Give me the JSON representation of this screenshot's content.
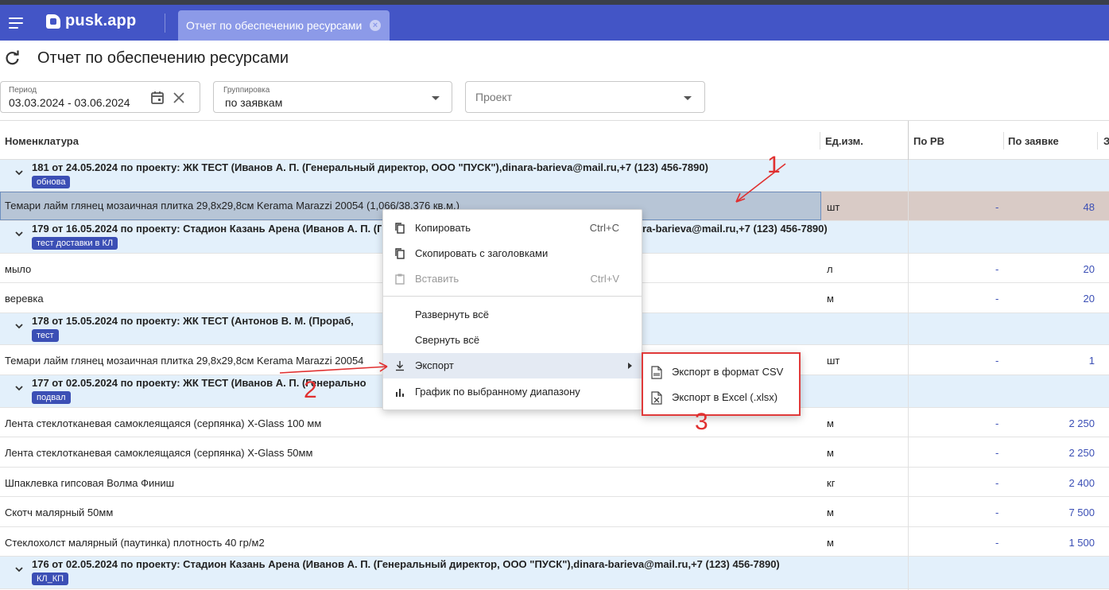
{
  "app": {
    "logo_text": "pusk.app",
    "tab_label": "Отчет по обеспечению ресурсами",
    "tab_close": "×"
  },
  "page": {
    "title": "Отчет по обеспечению ресурсами"
  },
  "filters": {
    "period_label": "Период",
    "period_value": "03.03.2024 - 03.06.2024",
    "grouping_label": "Группировка",
    "grouping_value": "по заявкам",
    "project_placeholder": "Проект"
  },
  "columns": {
    "nomenclature": "Номенклатура",
    "unit": "Ед.изм.",
    "by_rv": "По РВ",
    "by_request": "По заявке",
    "cut": "З"
  },
  "groups": [
    {
      "title": "181 от 24.05.2024 по проекту: ЖК ТЕСТ (Иванов А. П. (Генеральный директор, ООО \"ПУСК\"),dinara-barieva@mail.ru,+7 (123) 456-7890)",
      "tag": "обнова",
      "items": [
        {
          "name": "Темари лайм глянец мозаичная плитка 29,8x29,8см Kerama Marazzi 20054 (1,066/38,376 кв.м.)",
          "unit": "шт",
          "pv": "-",
          "qty": "48"
        }
      ]
    },
    {
      "title": "179 от 16.05.2024 по проекту: Стадион Казань Арена (Иванов А. П. (Генеральный директор, ООО \"ПУСК\"),dinara-barieva@mail.ru,+7 (123) 456-7890)",
      "tag": "тест доставки в КЛ",
      "items": [
        {
          "name": "мыло",
          "unit": "л",
          "pv": "-",
          "qty": "20"
        },
        {
          "name": "веревка",
          "unit": "м",
          "pv": "-",
          "qty": "20"
        }
      ]
    },
    {
      "title": "178 от 15.05.2024 по проекту: ЖК ТЕСТ (Антонов В. М. (Прораб,",
      "tag": "тест",
      "items": [
        {
          "name": "Темари лайм глянец мозаичная плитка 29,8x29,8см Kerama Marazzi 20054",
          "unit": "шт",
          "pv": "-",
          "qty": "1"
        }
      ]
    },
    {
      "title": "177 от 02.05.2024 по проекту: ЖК ТЕСТ (Иванов А. П. (Генерально",
      "tag": "подвал",
      "items": [
        {
          "name": "Лента стеклотканевая самоклеящаяся (серпянка) X-Glass 100 мм",
          "unit": "м",
          "pv": "-",
          "qty": "2 250"
        },
        {
          "name": "Лента стеклотканевая самоклеящаяся (серпянка) X-Glass 50мм",
          "unit": "м",
          "pv": "-",
          "qty": "2 250"
        },
        {
          "name": "Шпаклевка гипсовая Волма Финиш",
          "unit": "кг",
          "pv": "-",
          "qty": "2 400"
        },
        {
          "name": "Скотч малярный 50мм",
          "unit": "м",
          "pv": "-",
          "qty": "7 500"
        },
        {
          "name": "Стеклохолст малярный (паутинка) плотность 40 гр/м2",
          "unit": "м",
          "pv": "-",
          "qty": "1 500"
        }
      ]
    },
    {
      "title": "176 от 02.05.2024 по проекту: Стадион Казань Арена (Иванов А. П. (Генеральный директор, ООО \"ПУСК\"),dinara-barieva@mail.ru,+7 (123) 456-7890)",
      "tag": "КЛ_КП",
      "items": []
    }
  ],
  "group179_tail": "ra-barieva@mail.ru,+7 (123) 456-7890)",
  "context_menu": {
    "copy": "Копировать",
    "copy_shortcut": "Ctrl+C",
    "copy_headers": "Скопировать с заголовками",
    "paste": "Вставить",
    "paste_shortcut": "Ctrl+V",
    "expand_all": "Развернуть всё",
    "collapse_all": "Свернуть всё",
    "export": "Экспорт",
    "chart": "График по выбранному диапазону"
  },
  "export_submenu": {
    "csv": "Экспорт в формат CSV",
    "xlsx": "Экспорт в Excel (.xlsx)"
  },
  "annotations": {
    "n1": "1",
    "n2": "2",
    "n3": "3",
    "color": "#e03030"
  },
  "colors": {
    "appbar": "#4355c6",
    "tab": "#8c9ae8",
    "group_bg": "#e3f0fb",
    "tag_bg": "#3b4fb5",
    "selected_cell": "#b7c5d6"
  }
}
